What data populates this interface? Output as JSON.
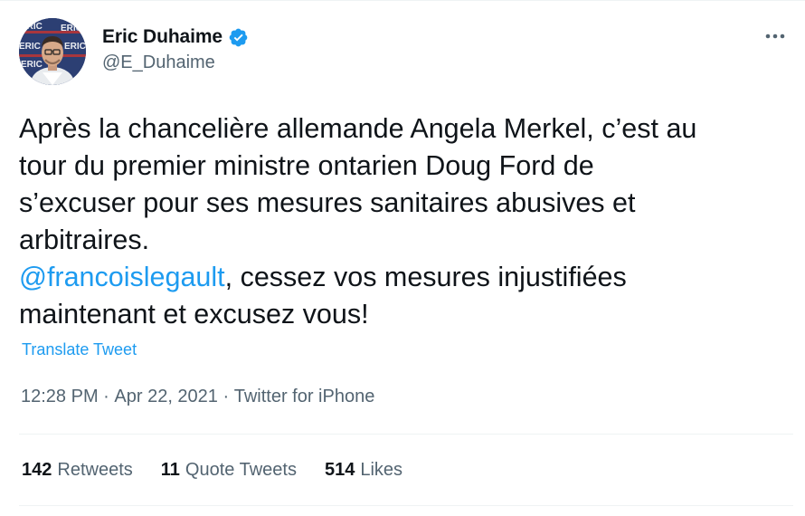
{
  "author": {
    "display_name": "Eric Duhaime",
    "handle": "@E_Duhaime",
    "avatar_backdrop_text": "ERIC"
  },
  "icons": {
    "verified": "verified-badge-icon",
    "more": "more-horizontal-icon"
  },
  "tweet": {
    "text_lines": [
      "Après la chancelière allemande Angela Merkel, c’est au",
      "tour du premier ministre ontarien Doug Ford de",
      "s’excuser pour ses mesures sanitaires abusives et",
      "arbitraires."
    ],
    "mention": "@francoislegault",
    "after_mention": ", cessez vos mesures injustifiées",
    "final_line": "maintenant et excusez vous!"
  },
  "translate_label": "Translate Tweet",
  "meta": {
    "time": "12:28 PM",
    "separator": " · ",
    "date": "Apr 22, 2021",
    "source": "Twitter for iPhone"
  },
  "stats": {
    "retweets": {
      "count": "142",
      "label": "Retweets"
    },
    "quote_tweets": {
      "count": "11",
      "label": "Quote Tweets"
    },
    "likes": {
      "count": "514",
      "label": "Likes"
    }
  },
  "colors": {
    "accent": "#1d9bf0",
    "text": "#0f1419",
    "secondary": "#536471",
    "divider": "#eff3f4"
  }
}
